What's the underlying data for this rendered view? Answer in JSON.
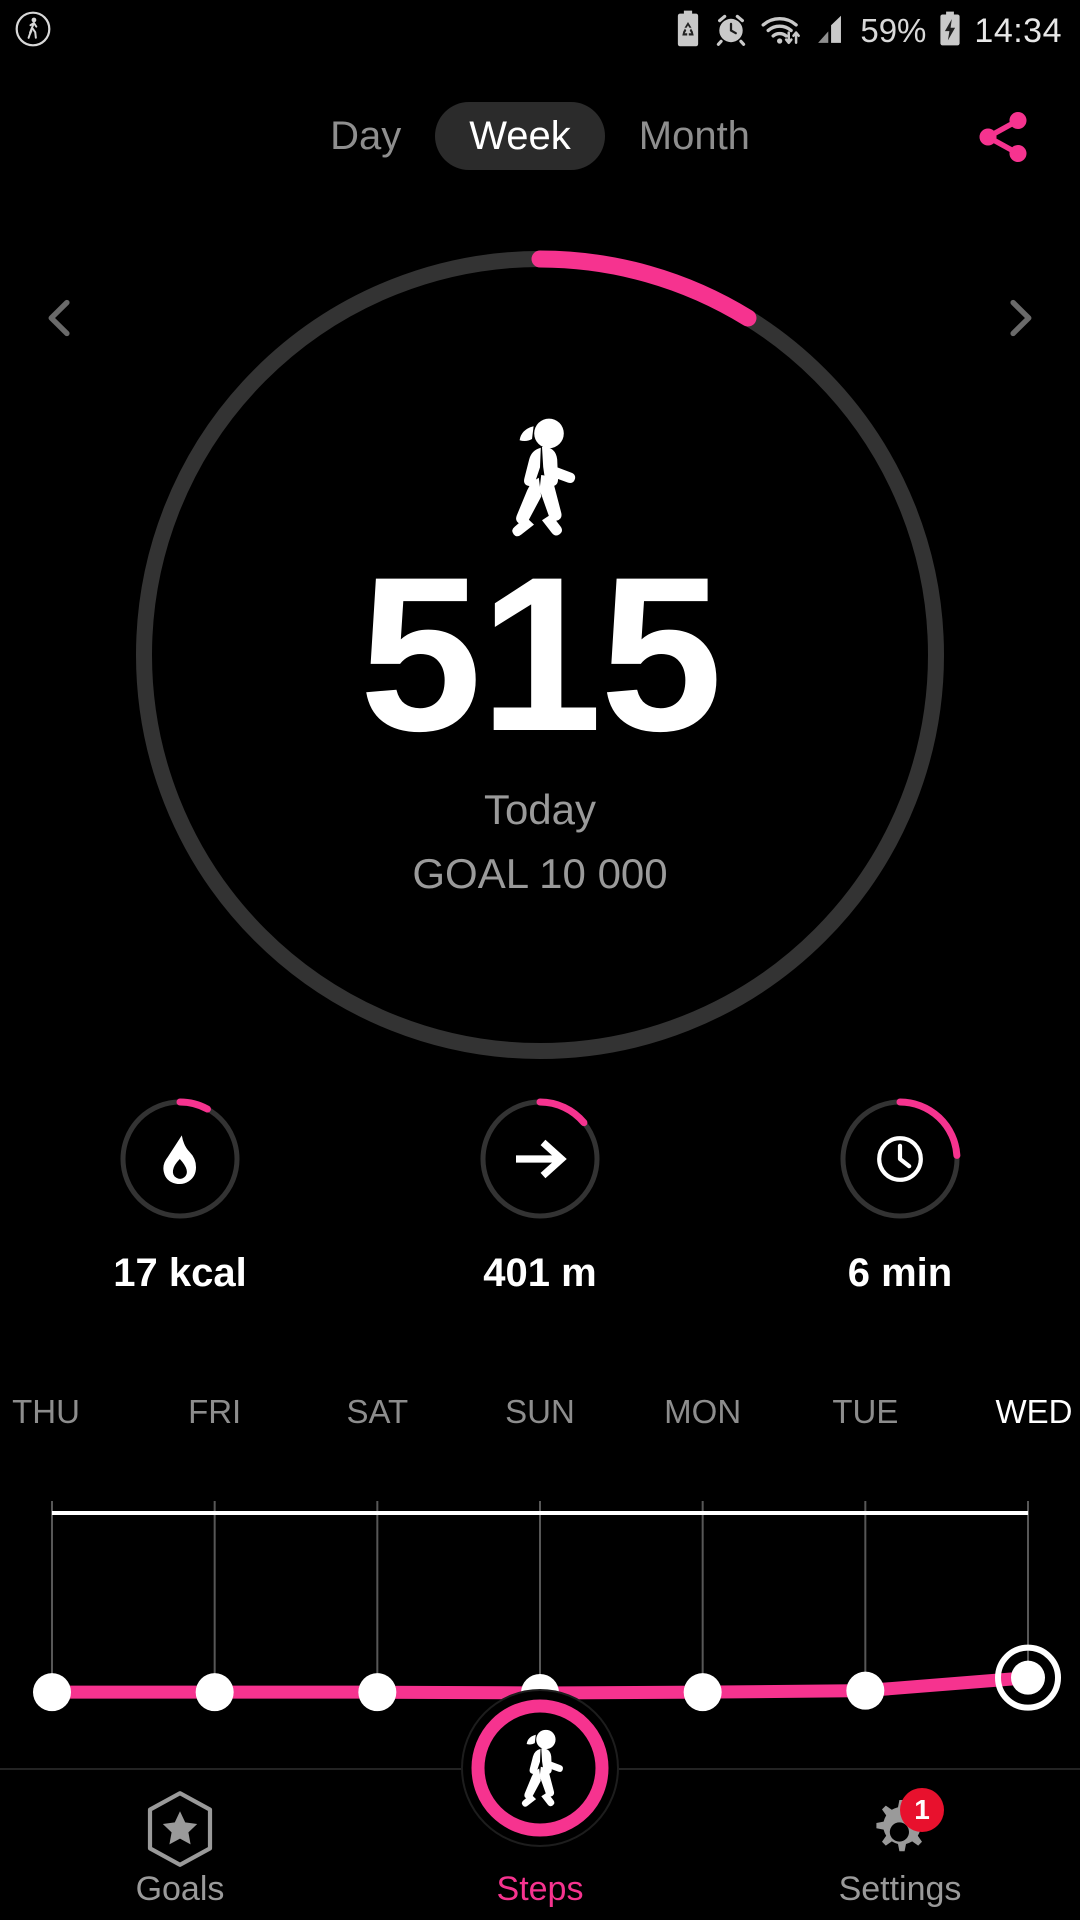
{
  "theme": {
    "accent": "#f6338f",
    "accent_soft": "#ff4d9d",
    "track": "#333333",
    "background": "#000000",
    "muted_text": "#8d8d8d",
    "badge_red": "#e8112d"
  },
  "status_bar": {
    "left_icons": [
      "pedestrian-icon"
    ],
    "right_icons": [
      "battery-saver-icon",
      "alarm-icon",
      "wifi-icon",
      "signal-icon",
      "charging-battery-icon"
    ],
    "battery_percent": "59%",
    "time": "14:34"
  },
  "tabs": {
    "items": [
      {
        "label": "Day",
        "active": false
      },
      {
        "label": "Week",
        "active": true
      },
      {
        "label": "Month",
        "active": false
      }
    ],
    "share_icon": "share-icon"
  },
  "nav_arrows": {
    "prev_icon": "chevron-left-icon",
    "next_icon": "chevron-right-icon"
  },
  "main_ring": {
    "icon": "walking-person-icon",
    "steps": "515",
    "period_label": "Today",
    "goal_label": "GOAL 10 000",
    "goal_value": 10000,
    "progress_percent": 5.15
  },
  "metrics": [
    {
      "icon": "flame-icon",
      "value": "17 kcal",
      "progress_percent": 8
    },
    {
      "icon": "arrow-right-icon",
      "value": "401 m",
      "progress_percent": 14
    },
    {
      "icon": "clock-icon",
      "value": "6 min",
      "progress_percent": 24
    }
  ],
  "chart_data": {
    "type": "line",
    "title": "",
    "xlabel": "",
    "ylabel": "",
    "categories": [
      "THU",
      "FRI",
      "SAT",
      "SUN",
      "MON",
      "TUE",
      "WED"
    ],
    "values": [
      430,
      430,
      430,
      420,
      430,
      450,
      620
    ],
    "ylim": [
      0,
      10000
    ],
    "grid": true,
    "legend": null,
    "highlight_index": 6,
    "highlight_label": "WED",
    "series": [
      {
        "name": "Steps",
        "values": [
          430,
          430,
          430,
          420,
          430,
          450,
          620
        ],
        "color": "#f6338f"
      }
    ],
    "goal_line": {
      "value": 10000,
      "color": "#ffffff",
      "visible": true
    }
  },
  "bottom_nav": {
    "items": [
      {
        "label": "Goals",
        "icon": "star-hexagon-icon",
        "active": false,
        "badge": null
      },
      {
        "label": "Steps",
        "icon": "walking-person-icon",
        "active": true,
        "badge": null
      },
      {
        "label": "Settings",
        "icon": "gear-icon",
        "active": false,
        "badge": "1"
      }
    ]
  }
}
